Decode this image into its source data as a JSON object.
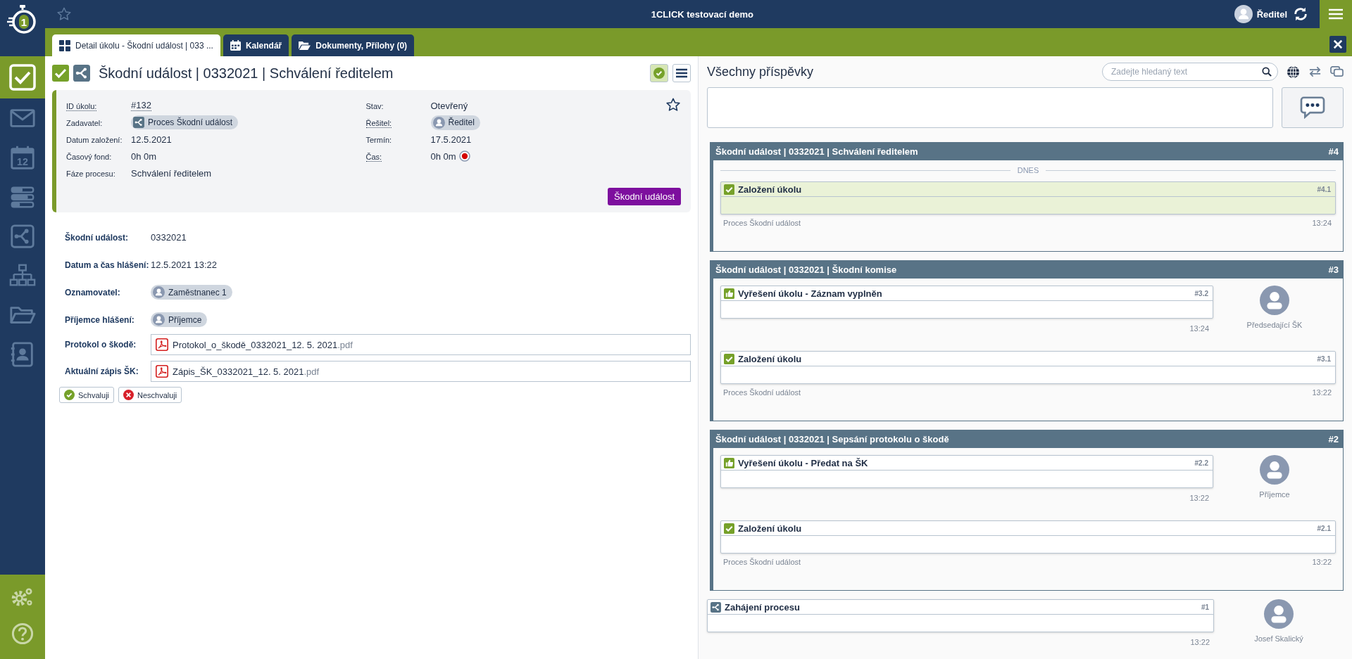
{
  "topbar": {
    "logo_mark": "1",
    "title": "1CLICK testovací demo",
    "user": "Ředitel",
    "starred": false
  },
  "sidebar": {
    "items": [
      {
        "kind": "tasks",
        "selected": true
      },
      {
        "kind": "mail",
        "selected": false
      },
      {
        "kind": "calendar",
        "label": "12",
        "selected": false
      },
      {
        "kind": "list",
        "selected": false
      },
      {
        "kind": "process",
        "selected": false
      },
      {
        "kind": "org",
        "selected": false
      },
      {
        "kind": "folder",
        "selected": false
      },
      {
        "kind": "contacts",
        "selected": false
      }
    ],
    "footer": [
      {
        "kind": "settings"
      },
      {
        "kind": "help"
      }
    ]
  },
  "tabs": [
    {
      "kind": "grid",
      "label": "Detail úkolu - Škodní událost | 033 ...",
      "selected": true
    },
    {
      "kind": "calendar",
      "label": "Kalendář",
      "selected": false
    },
    {
      "kind": "folder",
      "label": "Dokumenty, Přílohy (0)",
      "selected": false
    }
  ],
  "task": {
    "title": "Škodní událost | 0332021 | Schválení ředitelem",
    "done": true,
    "starred": false,
    "category": "Škodní událost",
    "left_fields": [
      {
        "label": "ID úkolu:",
        "value": "#132",
        "kind": "text",
        "underlined": true
      },
      {
        "label": "Zadavatel:",
        "value": "Proces Škodní událost",
        "kind": "process",
        "underlined": false
      },
      {
        "label": "Datum založení:",
        "value": "12.5.2021",
        "kind": "text",
        "underlined": false
      },
      {
        "label": "Časový fond:",
        "value": "0h 0m",
        "kind": "text",
        "underlined": false
      },
      {
        "label": "Fáze procesu:",
        "value": "Schválení ředitelem",
        "kind": "text",
        "underlined": false
      }
    ],
    "right_fields": [
      {
        "label": "Stav:",
        "value": "Otevřený",
        "kind": "text",
        "underlined": false
      },
      {
        "label": "Řešitel:",
        "value": "Ředitel",
        "kind": "person",
        "underlined": true
      },
      {
        "label": "Termín:",
        "value": "17.5.2021",
        "kind": "text",
        "underlined": false
      },
      {
        "label": "Čas:",
        "value": "0h 0m",
        "kind": "timer",
        "underlined": true
      }
    ]
  },
  "form": {
    "fields": [
      {
        "label": "Škodní událost:",
        "kind": "text",
        "value": "0332021"
      },
      {
        "label": "Datum a čas hlášení:",
        "kind": "text",
        "value": "12.5.2021 13:22"
      },
      {
        "label": "Oznamovatel:",
        "kind": "person",
        "value": "Zaměstnanec 1"
      },
      {
        "label": "Příjemce hlášení:",
        "kind": "person",
        "value": "Příjemce"
      },
      {
        "label": "Protokol o škodě:",
        "kind": "file",
        "value": "Protokol_o_škodě_0332021_12. 5. 2021",
        "extension": ".pdf"
      },
      {
        "label": "Aktuální zápis ŠK:",
        "kind": "file",
        "value": "Zápis_ŠK_0332021_12. 5. 2021",
        "extension": ".pdf"
      }
    ],
    "buttons": [
      {
        "kind": "approve",
        "label": "Schvaluji"
      },
      {
        "kind": "reject",
        "label": "Neschvaluji"
      }
    ]
  },
  "feed": {
    "title": "Všechny příspěvky",
    "search_placeholder": "Zadejte hledaný text",
    "items": [
      {
        "kind": "group",
        "title": "Škodní událost | 0332021 | Schválení ředitelem",
        "number": "#4",
        "day": "DNES",
        "posts": [
          {
            "kind": "check",
            "title": "Založení úkolu",
            "number": "#4.1",
            "highlighted": true,
            "source": "Proces Škodní událost",
            "time": "13:24"
          }
        ]
      },
      {
        "kind": "group",
        "title": "Škodní událost | 0332021 | Škodní komise",
        "number": "#3",
        "posts": [
          {
            "kind": "thumb",
            "title": "Vyřešení úkolu - Záznam vyplněn",
            "number": "#3.2",
            "highlighted": false,
            "author": "Předsedající ŠK",
            "time": "13:24"
          },
          {
            "kind": "check",
            "title": "Založení úkolu",
            "number": "#3.1",
            "highlighted": false,
            "source": "Proces Škodní událost",
            "time": "13:22"
          }
        ]
      },
      {
        "kind": "group",
        "title": "Škodní událost | 0332021 | Sepsání protokolu o škodě",
        "number": "#2",
        "posts": [
          {
            "kind": "thumb",
            "title": "Vyřešení úkolu - Předat na ŠK",
            "number": "#2.2",
            "highlighted": false,
            "author": "Příjemce",
            "time": "13:22"
          },
          {
            "kind": "check",
            "title": "Založení úkolu",
            "number": "#2.1",
            "highlighted": false,
            "source": "Proces Škodní událost",
            "time": "13:22"
          }
        ]
      },
      {
        "kind": "post",
        "post": {
          "kind": "process",
          "title": "Zahájení procesu",
          "number": "#1",
          "highlighted": false,
          "author": "Josef Skalický",
          "time": "13:22"
        }
      }
    ]
  }
}
